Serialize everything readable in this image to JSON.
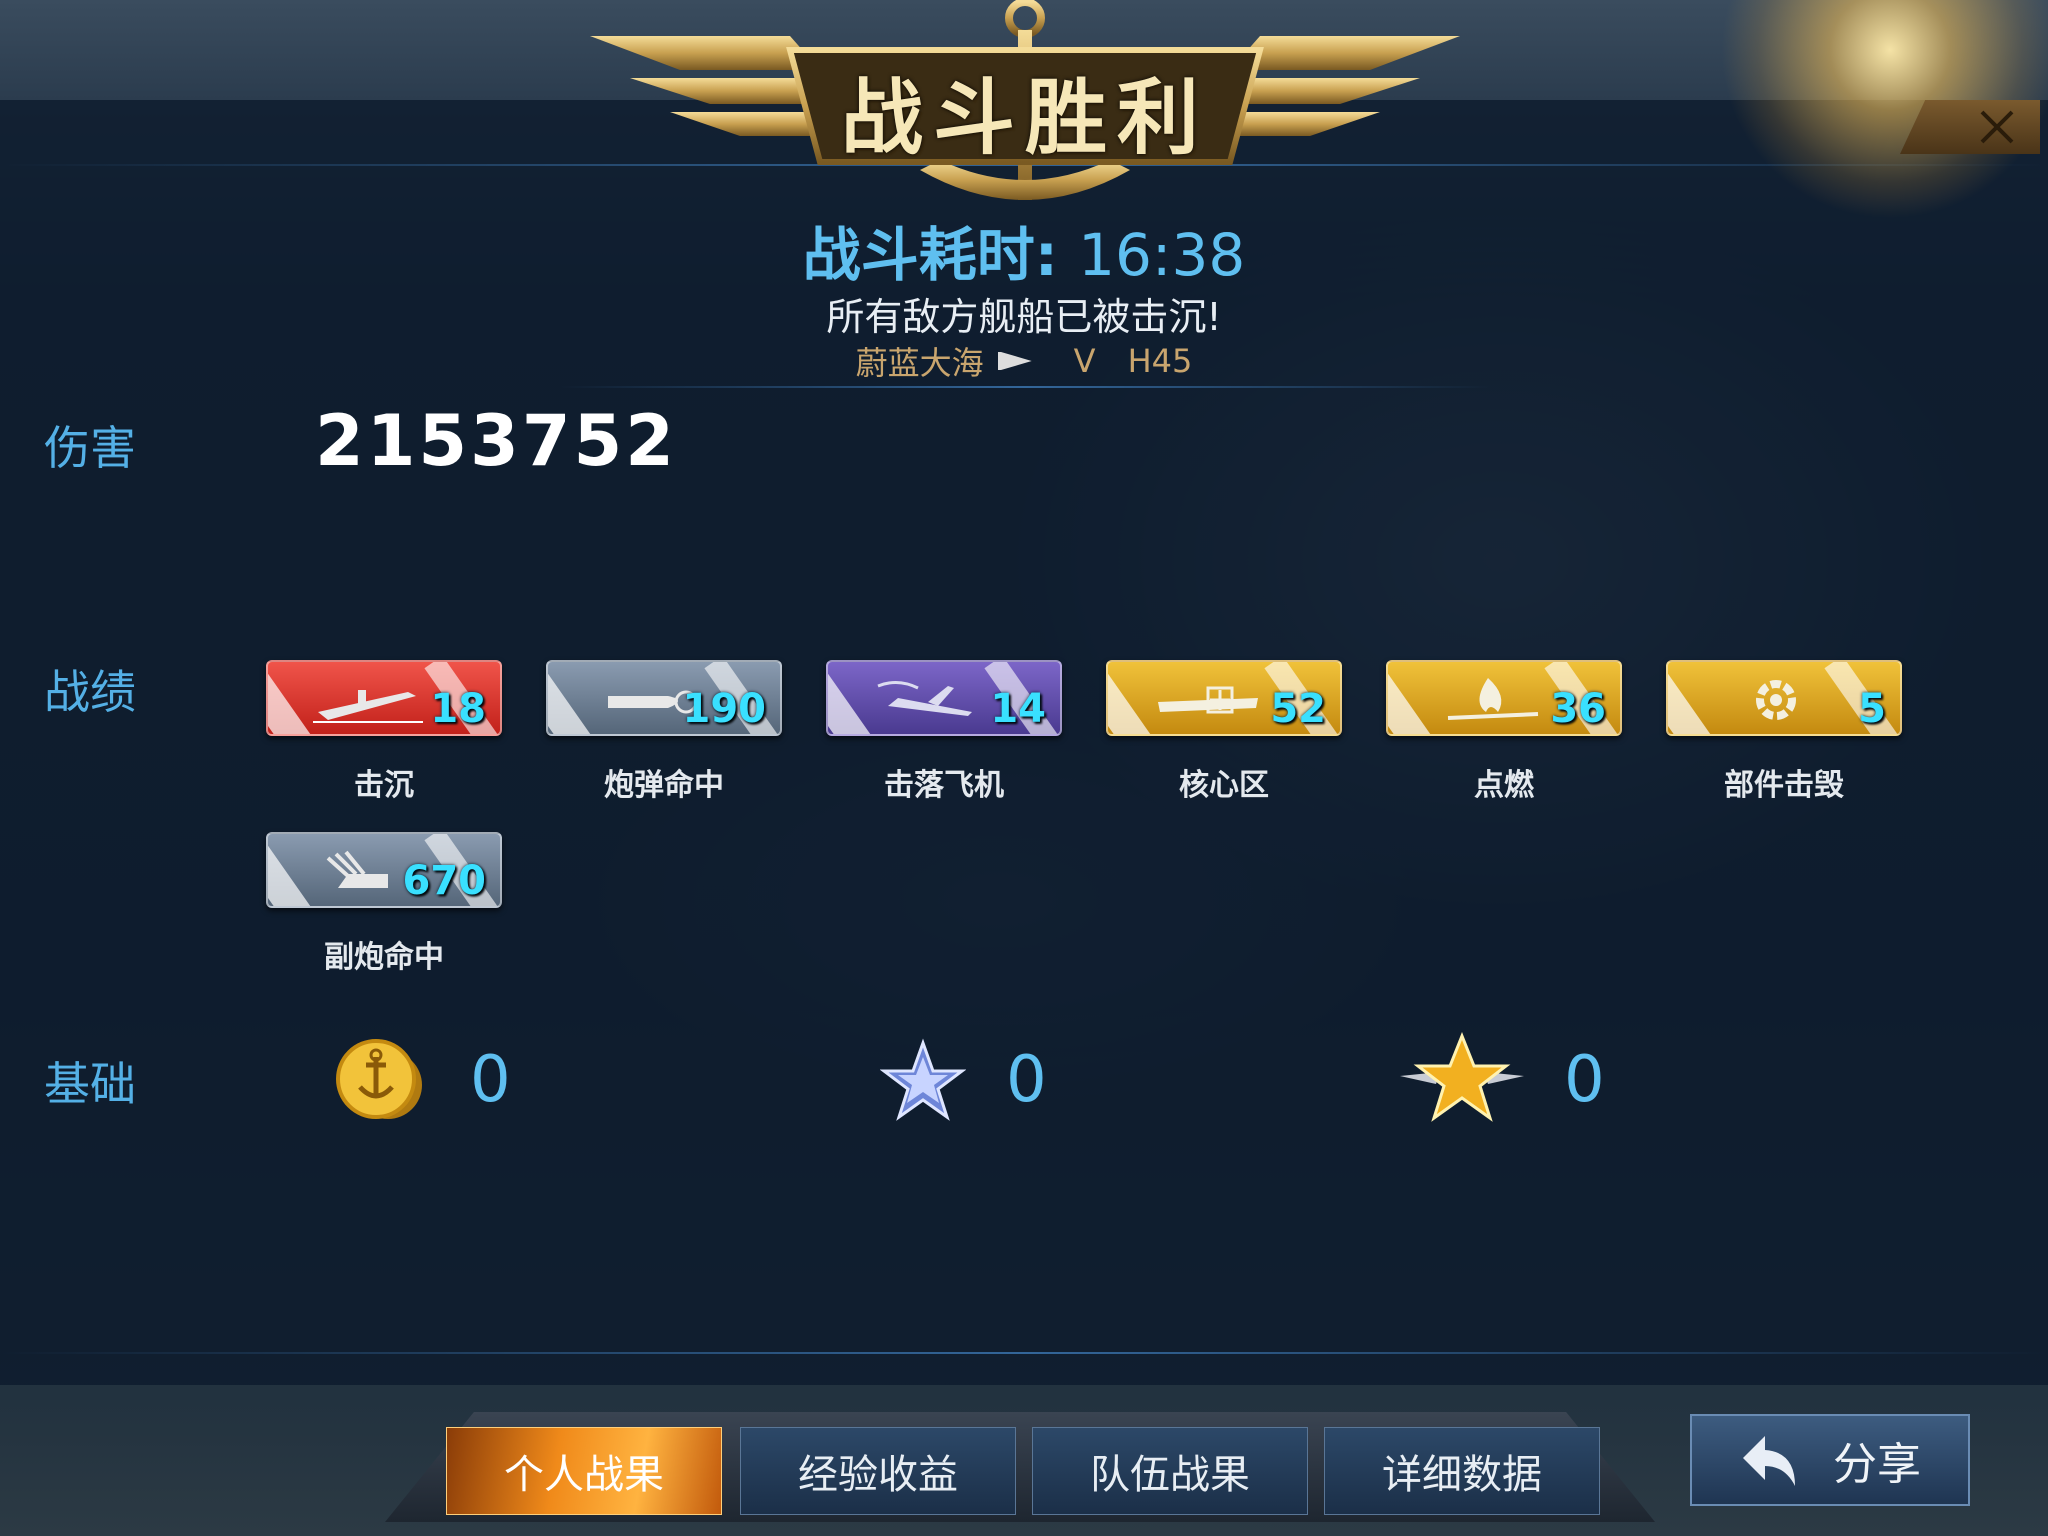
{
  "header": {
    "title": "战斗胜利",
    "duration_label": "战斗耗时:",
    "duration_value": "16:38",
    "summary": "所有敌方舰船已被击沉!",
    "map_name": "蔚蓝大海",
    "tier": "V",
    "ship": "H45"
  },
  "damage": {
    "label": "伤害",
    "value": "2153752"
  },
  "record": {
    "label": "战绩",
    "items": [
      {
        "label": "击沉",
        "value": "18",
        "color": "#d8342a",
        "icon": "sinking-ship-icon"
      },
      {
        "label": "炮弹命中",
        "value": "190",
        "color": "#6e8098",
        "icon": "shell-icon"
      },
      {
        "label": "击落飞机",
        "value": "14",
        "color": "#5f4cae",
        "icon": "aircraft-shot-icon"
      },
      {
        "label": "核心区",
        "value": "52",
        "color": "#d9a420",
        "icon": "citadel-icon"
      },
      {
        "label": "点燃",
        "value": "36",
        "color": "#d9a420",
        "icon": "fire-icon"
      },
      {
        "label": "部件击毁",
        "value": "5",
        "color": "#d9a420",
        "icon": "gear-icon"
      },
      {
        "label": "副炮命中",
        "value": "670",
        "color": "#6e8098",
        "icon": "secondary-gun-icon"
      }
    ]
  },
  "base": {
    "label": "基础",
    "items": [
      {
        "icon": "gold-coin-icon",
        "value": "0"
      },
      {
        "icon": "blue-star-icon",
        "value": "0"
      },
      {
        "icon": "gold-star-icon",
        "value": "0"
      }
    ]
  },
  "tabs": [
    {
      "label": "个人战果",
      "active": true
    },
    {
      "label": "经验收益",
      "active": false
    },
    {
      "label": "队伍战果",
      "active": false
    },
    {
      "label": "详细数据",
      "active": false
    }
  ],
  "share": {
    "label": "分享"
  },
  "colors": {
    "accent": "#5fbff0",
    "number": "#39e0ff",
    "gold": "#c9a56e"
  }
}
